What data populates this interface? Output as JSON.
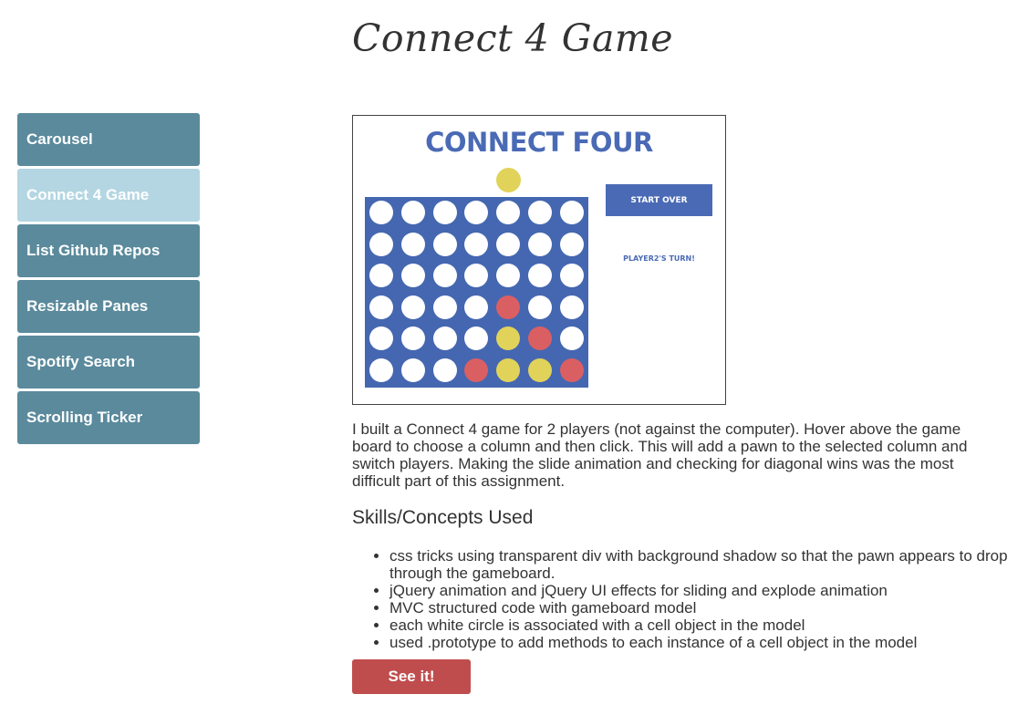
{
  "page": {
    "title": "Connect 4 Game"
  },
  "sidebar": {
    "items": [
      {
        "label": "Carousel"
      },
      {
        "label": "Connect 4 Game"
      },
      {
        "label": "List Github Repos"
      },
      {
        "label": "Resizable Panes"
      },
      {
        "label": "Spotify Search"
      },
      {
        "label": "Scrolling Ticker"
      }
    ],
    "active_index": 1
  },
  "screenshot": {
    "title": "CONNECT FOUR",
    "start_button": "START OVER",
    "turn_text": "PLAYER2'S TURN!",
    "board": [
      [
        "white",
        "white",
        "white",
        "white",
        "white",
        "white",
        "white"
      ],
      [
        "white",
        "white",
        "white",
        "white",
        "white",
        "white",
        "white"
      ],
      [
        "white",
        "white",
        "white",
        "white",
        "white",
        "white",
        "white"
      ],
      [
        "white",
        "white",
        "white",
        "white",
        "red",
        "white",
        "white"
      ],
      [
        "white",
        "white",
        "white",
        "white",
        "yellow",
        "red",
        "white"
      ],
      [
        "white",
        "white",
        "white",
        "red",
        "yellow",
        "yellow",
        "red"
      ]
    ],
    "colors": {
      "board": "#4567b1",
      "red": "#da5f63",
      "yellow": "#e1d35a",
      "title": "#4a6ab5"
    }
  },
  "description": "I built a Connect 4 game for 2 players (not against the computer). Hover above the game board to choose a column and then click. This will add a pawn to the selected column and switch players. Making the slide animation and checking for diagonal wins was the most difficult part of this assignment.",
  "skills": {
    "heading": "Skills/Concepts Used",
    "items": [
      "css tricks using transparent div with background shadow so that the pawn appears to drop through the gameboard.",
      "jQuery animation and jQuery UI effects for sliding and explode animation",
      "MVC structured code with gameboard model",
      "each white circle is associated with a cell object in the model",
      "used .prototype to add methods to each instance of a cell object in the model"
    ]
  },
  "cta": {
    "label": "See it!"
  },
  "colors": {
    "sidebar": "#5a8a9c",
    "sidebar_active": "#b3d6e2",
    "cta": "#c04d4d"
  }
}
